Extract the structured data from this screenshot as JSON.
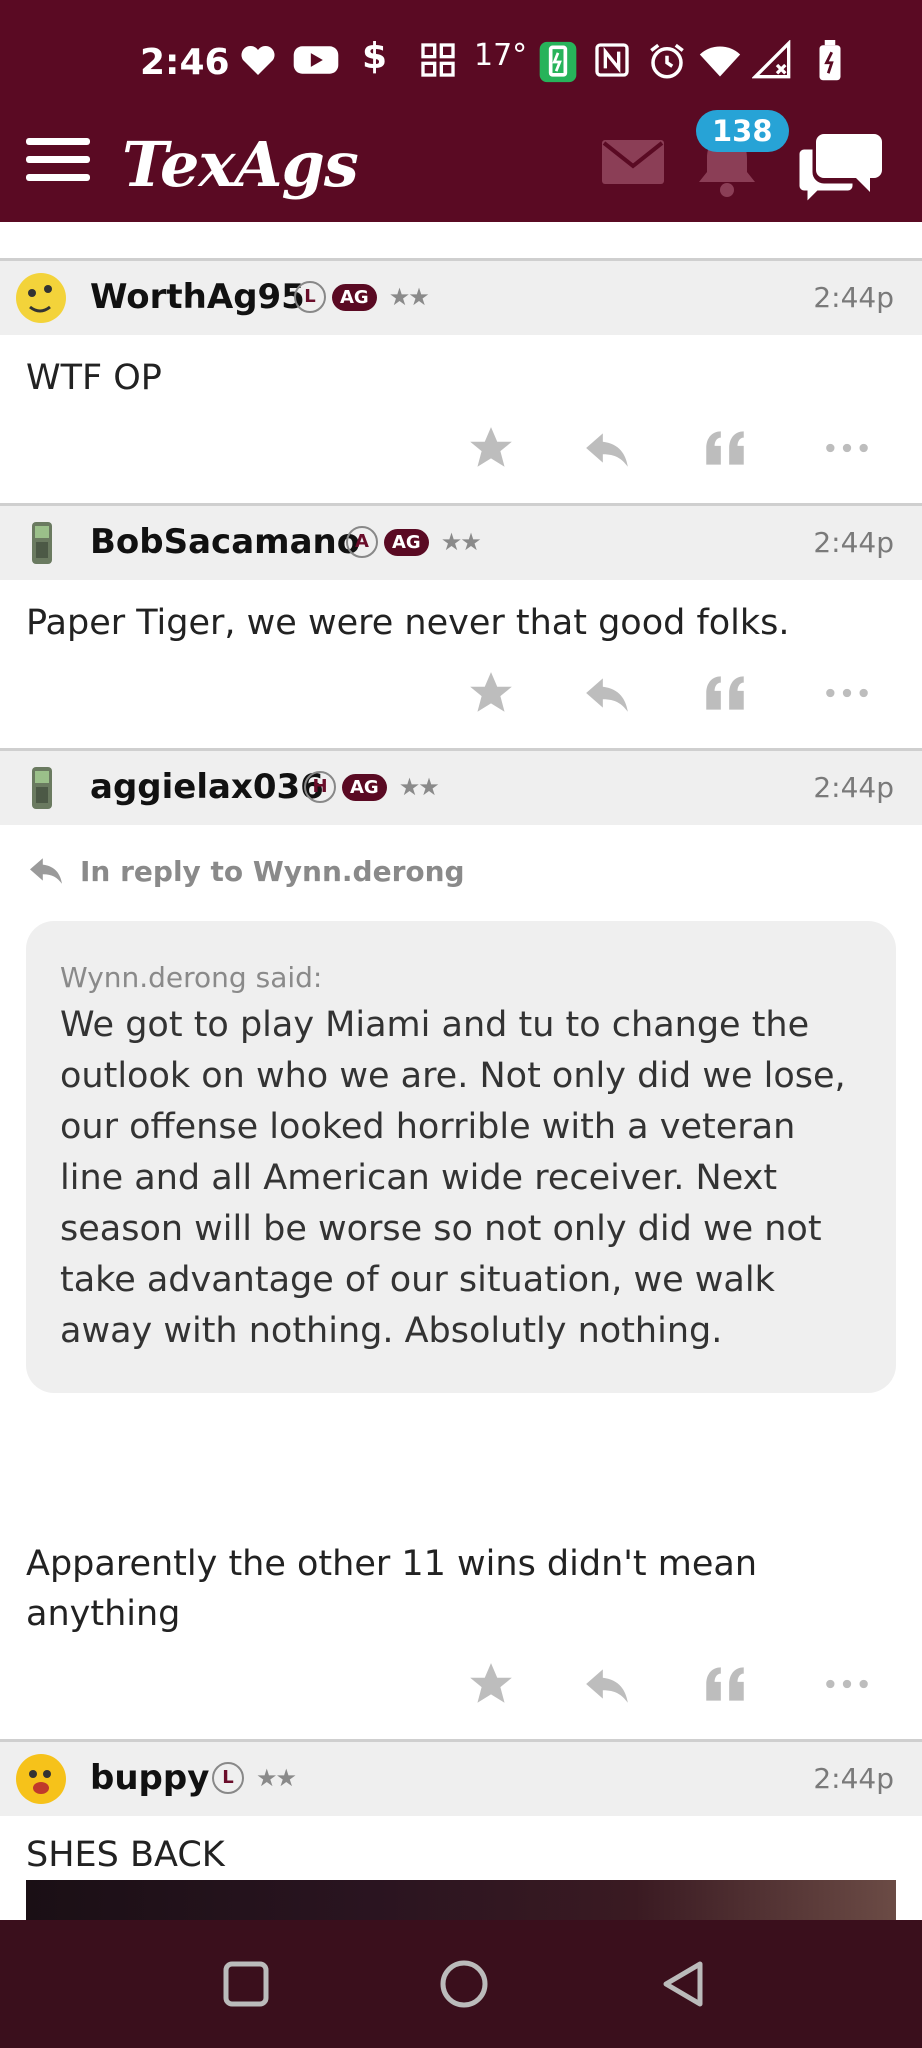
{
  "status_bar": {
    "time": "2:46",
    "temperature": "17°"
  },
  "app": {
    "logo": "TexAgs",
    "notification_count": "138"
  },
  "posts": [
    {
      "username": "WorthAg95",
      "badges": [
        "L",
        "AG"
      ],
      "stars": "★★",
      "time": "2:44p",
      "text": "WTF OP"
    },
    {
      "username": "BobSacamano",
      "badges": [
        "A",
        "AG"
      ],
      "stars": "★★",
      "time": "2:44p",
      "text": "Paper Tiger, we were never that good folks."
    },
    {
      "username": "aggielax036",
      "badges": [
        "H",
        "AG"
      ],
      "stars": "★★",
      "time": "2:44p",
      "reply_to": "In reply to Wynn.derong",
      "quote_author": "Wynn.derong said:",
      "quote_text": "We got to play Miami and tu to change the outlook on who we are. Not only did we lose, our offense looked horrible with a veteran line and all American wide receiver. Next season will be worse so not only did we not take advantage of our situation, we walk away with nothing. Absolutly nothing.",
      "text": "Apparently the other 11 wins didn't mean anything"
    },
    {
      "username": "buppy",
      "badges": [
        "L"
      ],
      "stars": "★★",
      "time": "2:44p",
      "text": "SHES BACK"
    }
  ],
  "icons": {
    "star": "star-icon",
    "reply": "reply-icon",
    "quote": "quote-icon",
    "more": "more-icon"
  },
  "colors": {
    "brand": "#5a0a23",
    "badge_blue": "#27a3d6",
    "navbar": "#3a0f1c"
  }
}
